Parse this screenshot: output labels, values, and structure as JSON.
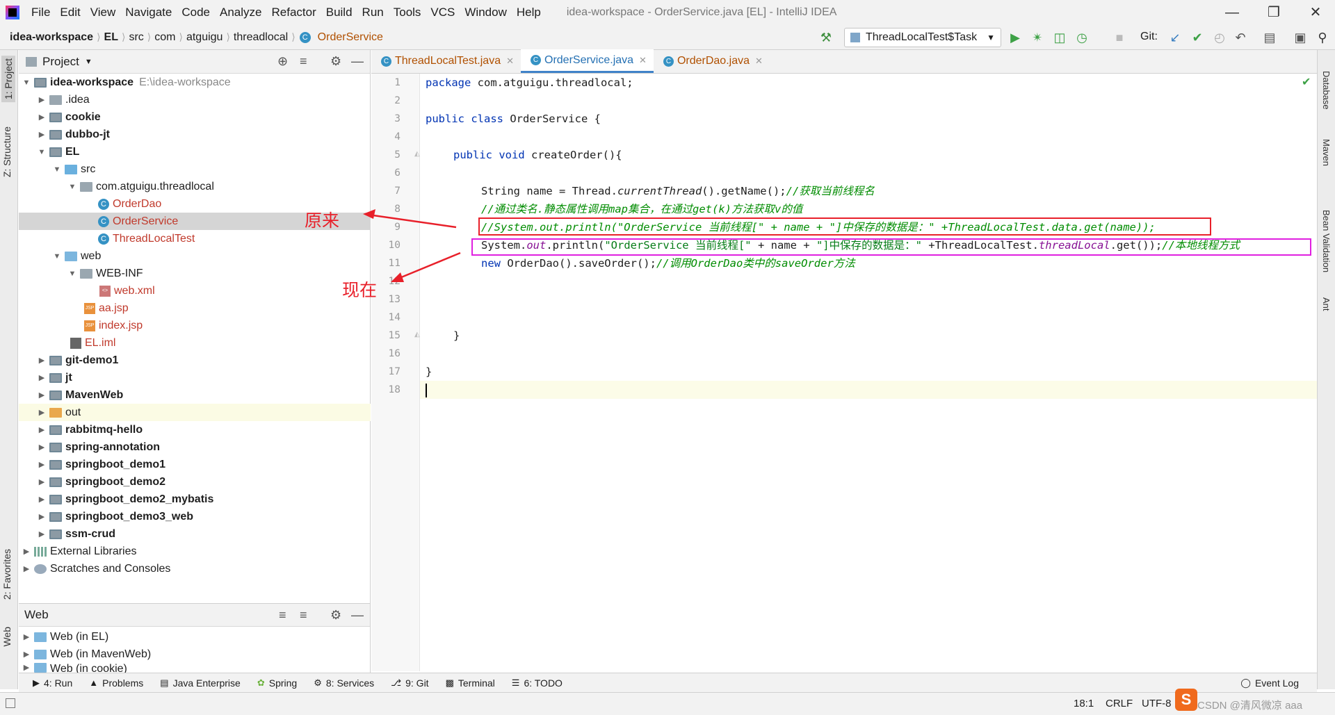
{
  "window": {
    "title": "idea-workspace - OrderService.java [EL] - IntelliJ IDEA"
  },
  "menu": [
    "File",
    "Edit",
    "View",
    "Navigate",
    "Code",
    "Analyze",
    "Refactor",
    "Build",
    "Run",
    "Tools",
    "VCS",
    "Window",
    "Help"
  ],
  "breadcrumb": [
    "idea-workspace",
    "EL",
    "src",
    "com",
    "atguigu",
    "threadlocal",
    "OrderService"
  ],
  "toolbar": {
    "run_config": "ThreadLocalTest$Task",
    "git_label": "Git:"
  },
  "left_tabs": {
    "project": "1: Project",
    "structure": "Z: Structure",
    "favorites": "2: Favorites",
    "web": "Web"
  },
  "right_tabs": {
    "database": "Database",
    "maven": "Maven",
    "bean": "Bean Validation",
    "ant": "Ant"
  },
  "project": {
    "title": "Project",
    "root_name": "idea-workspace",
    "root_path": "E:\\idea-workspace",
    "items": [
      ".idea",
      "cookie",
      "dubbo-jt",
      "EL",
      "src",
      "com.atguigu.threadlocal",
      "OrderDao",
      "OrderService",
      "ThreadLocalTest",
      "web",
      "WEB-INF",
      "web.xml",
      "aa.jsp",
      "index.jsp",
      "EL.iml",
      "git-demo1",
      "jt",
      "MavenWeb",
      "out",
      "rabbitmq-hello",
      "spring-annotation",
      "springboot_demo1",
      "springboot_demo2",
      "springboot_demo2_mybatis",
      "springboot_demo3_web",
      "ssm-crud",
      "External Libraries",
      "Scratches and Consoles"
    ]
  },
  "web_panel": {
    "title": "Web",
    "items": [
      "Web (in EL)",
      "Web (in MavenWeb)",
      "Web (in cookie)"
    ]
  },
  "tabs": [
    "ThreadLocalTest.java",
    "OrderService.java",
    "OrderDao.java"
  ],
  "code": {
    "l1_kw": "package",
    "l1_rest": " com.atguigu.threadlocal;",
    "l3_kw": "public class",
    "l3_rest": " OrderService {",
    "l5_kw": "public void",
    "l5_rest": " createOrder(){",
    "l7_a": "String name = Thread.",
    "l7_it": "currentThread",
    "l7_b": "().getName();",
    "l7_cm": "//获取当前线程名",
    "l8_cm": "//通过类名.静态属性调用map集合，在通过get(k)方法获取v的值",
    "l9_cm": "//System.out.println(\"OrderService 当前线程[\" + name + \"]中保存的数据是：\" +ThreadLocalTest.data.get(name));",
    "l10_a": "System.",
    "l10_it": "out",
    "l10_b": ".println(",
    "l10_s1": "\"OrderService 当前线程[\"",
    "l10_c": " + name + ",
    "l10_s2": "\"]中保存的数据是：\"",
    "l10_d": " +ThreadLocalTest.",
    "l10_it2": "threadLocal",
    "l10_e": ".get());",
    "l10_cm": "//本地线程方式",
    "l11_kw": "new",
    "l11_rest": " OrderDao().saveOrder();",
    "l11_cm": "//调用OrderDao类中的saveOrder方法",
    "l15": "}",
    "l17": "}"
  },
  "annotations": {
    "before": "原来",
    "now": "现在"
  },
  "bottom_tabs": [
    "4: Run",
    "Problems",
    "Java Enterprise",
    "Spring",
    "8: Services",
    "9: Git",
    "Terminal",
    "6: TODO",
    "Event Log"
  ],
  "status": {
    "position": "18:1",
    "line_sep": "CRLF",
    "encoding": "UTF-8",
    "watermark": "CSDN @清风微凉 aaa"
  }
}
